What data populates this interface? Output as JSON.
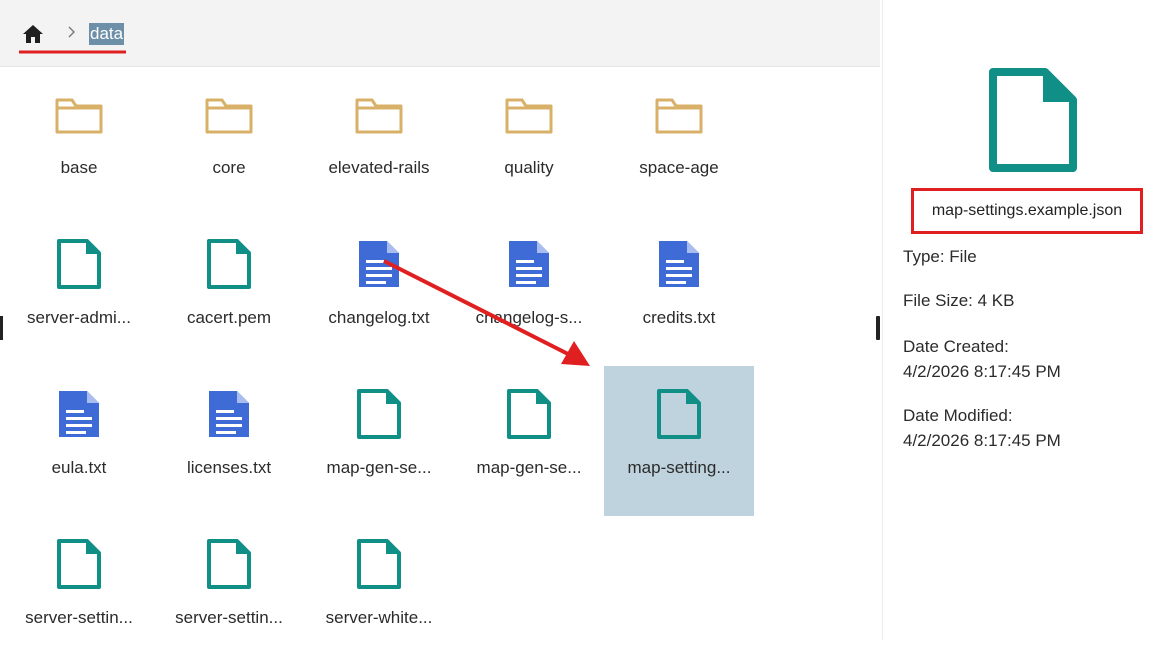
{
  "breadcrumb": {
    "current": "data"
  },
  "items": [
    {
      "label": "base",
      "kind": "folder"
    },
    {
      "label": "core",
      "kind": "folder"
    },
    {
      "label": "elevated-rails",
      "kind": "folder"
    },
    {
      "label": "quality",
      "kind": "folder"
    },
    {
      "label": "space-age",
      "kind": "folder"
    },
    {
      "label": "server-admi...",
      "kind": "file"
    },
    {
      "label": "cacert.pem",
      "kind": "file"
    },
    {
      "label": "changelog.txt",
      "kind": "text"
    },
    {
      "label": "changelog-s...",
      "kind": "text"
    },
    {
      "label": "credits.txt",
      "kind": "text"
    },
    {
      "label": "eula.txt",
      "kind": "text"
    },
    {
      "label": "licenses.txt",
      "kind": "text"
    },
    {
      "label": "map-gen-se...",
      "kind": "file"
    },
    {
      "label": "map-gen-se...",
      "kind": "file"
    },
    {
      "label": "map-setting...",
      "kind": "file",
      "selected": true
    },
    {
      "label": "server-settin...",
      "kind": "file"
    },
    {
      "label": "server-settin...",
      "kind": "file"
    },
    {
      "label": "server-white...",
      "kind": "file"
    }
  ],
  "details": {
    "name": "map-settings.example.json",
    "type": "Type: File",
    "size": "File Size: 4 KB",
    "created_label": "Date Created:",
    "created_value": "4/2/2026 8:17:45 PM",
    "modified_label": "Date Modified:",
    "modified_value": "4/2/2026 8:17:45 PM"
  },
  "colors": {
    "folder": "#d8b068",
    "file": "#0f8f86",
    "text": "#3f6bd6",
    "selected": "#bfd3de",
    "annotation": "#e02020"
  },
  "icons": {
    "home": "home-icon",
    "separator": "chevron-right-icon",
    "folder": "folder-icon",
    "file": "file-icon",
    "text": "text-file-icon"
  }
}
